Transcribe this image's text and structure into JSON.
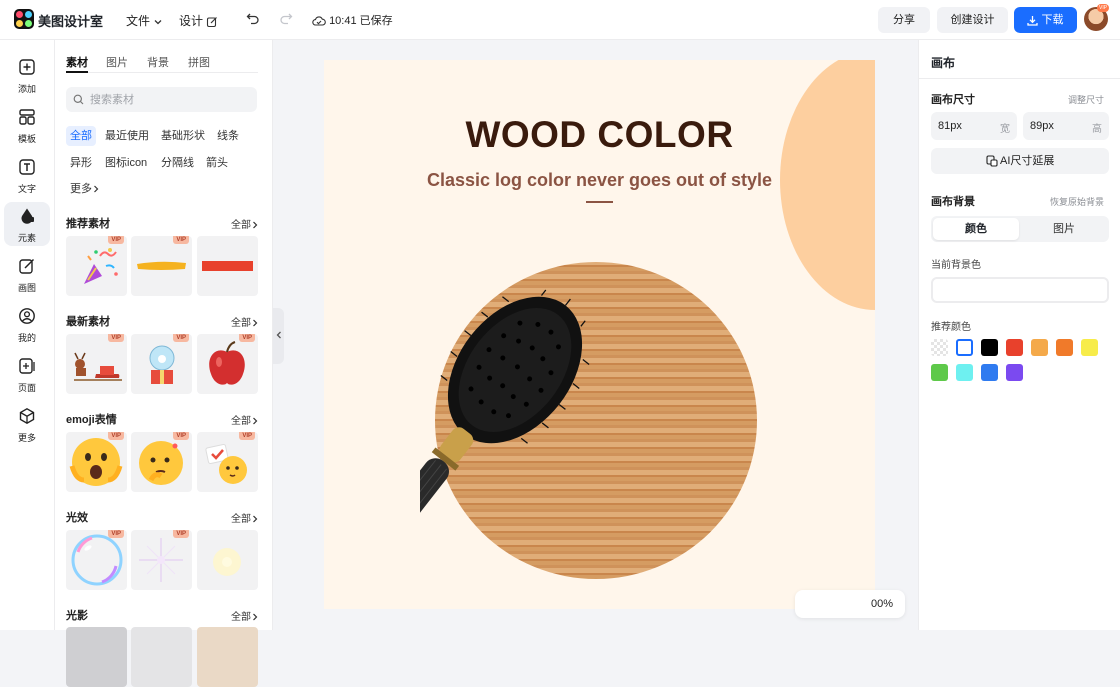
{
  "header": {
    "app_name": "美图设计室",
    "menu_file": "文件",
    "menu_design": "设计",
    "save_status": "10:41 已保存",
    "share_label": "分享",
    "create_label": "创建设计",
    "download_label": "下载",
    "avatar_badge": "VIP"
  },
  "nav": [
    {
      "label": "添加",
      "icon": "plus-square-icon"
    },
    {
      "label": "模板",
      "icon": "template-icon"
    },
    {
      "label": "文字",
      "icon": "text-icon"
    },
    {
      "label": "元素",
      "icon": "shapes-icon"
    },
    {
      "label": "画图",
      "icon": "draw-icon"
    },
    {
      "label": "我的",
      "icon": "user-icon"
    },
    {
      "label": "页面",
      "icon": "page-add-icon"
    },
    {
      "label": "更多",
      "icon": "cube-icon"
    }
  ],
  "panel": {
    "tabs": [
      "素材",
      "图片",
      "背景",
      "拼图"
    ],
    "search_placeholder": "搜索素材",
    "chips": [
      "全部",
      "最近使用",
      "基础形状",
      "线条",
      "异形",
      "图标icon",
      "分隔线",
      "箭头",
      "更多"
    ],
    "vip": "VIP",
    "sections": [
      {
        "title": "推荐素材",
        "all": "全部"
      },
      {
        "title": "最新素材",
        "all": "全部"
      },
      {
        "title": "emoji表情",
        "all": "全部"
      },
      {
        "title": "光效",
        "all": "全部"
      },
      {
        "title": "光影",
        "all": "全部"
      }
    ]
  },
  "canvas": {
    "headline": "WOOD COLOR",
    "subline": "Classic log color never goes out of style",
    "zoom": "00%",
    "colors": {
      "bg": "#fff6eb",
      "accent_circle": "#fdcf9f",
      "headline": "#3a1b0d",
      "subline": "#8b5443"
    }
  },
  "right": {
    "title": "画布",
    "size_label": "画布尺寸",
    "resize_link": "调整尺寸",
    "width_value": "81px",
    "width_unit": "宽",
    "height_value": "89px",
    "height_unit": "高",
    "ai_extend": "AI尺寸延展",
    "bg_label": "画布背景",
    "restore_link": "恢复原始背景",
    "seg_color": "颜色",
    "seg_image": "图片",
    "current_bg": "当前背景色",
    "recommended": "推荐颜色",
    "swatches": [
      "transparent",
      "#ffffff",
      "#000000",
      "#e8412c",
      "#f4a94a",
      "#f07a2a",
      "#f7ec4a",
      "#5ec94a",
      "#6ef0f0",
      "#2f7bf0",
      "#7b4af0"
    ]
  }
}
